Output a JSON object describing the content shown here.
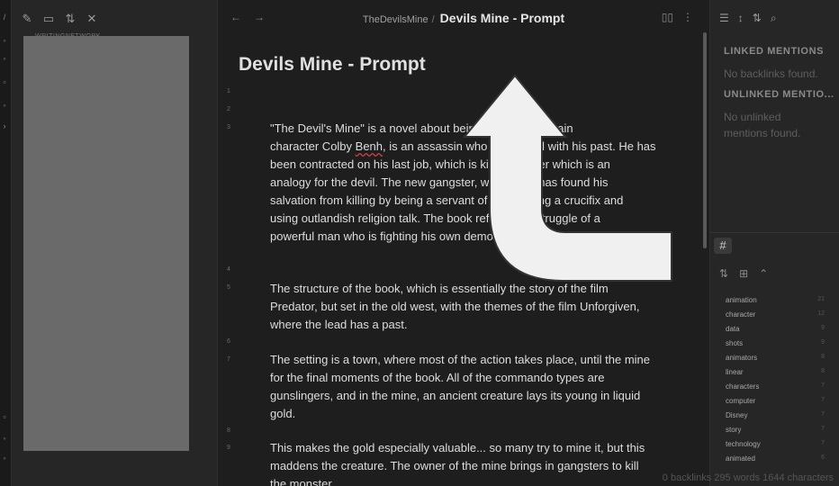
{
  "left_sidebar": {
    "vault_label": "WRITINGNETWORK"
  },
  "header": {
    "breadcrumb_parent": "TheDevilsMine",
    "breadcrumb_separator": "/",
    "breadcrumb_current": "Devils Mine - Prompt"
  },
  "document": {
    "title": "Devils Mine - Prompt",
    "line_numbers": [
      "1",
      "2",
      "3",
      "4",
      "5",
      "6",
      "7",
      "8",
      "9"
    ],
    "paragraphs": [
      {
        "before": "\"The Devil's Mine\" is a novel about being ",
        "after_hidden": "",
        "lines": [
          "\"The Devil's Mine\" is a novel about being a killer. The main",
          "character Colby Benh, is an assassin who is haunted with his past. He has",
          "been contracted on his last job, which is kill a monster which is an",
          "analogy for the devil. The new gangster, who finally has found his",
          "salvation from killing by being a servant of god holding a crucifix and",
          "using outlandish religion talk. The book reflects the struggle of a",
          "powerful man who is fighting his own demons as a protector."
        ]
      },
      {
        "lines": [
          "The structure of the book, which is essentially the story of the film",
          "Predator, but set in the old west, with the themes of the film Unforgiven,",
          "where the lead has a past."
        ]
      },
      {
        "lines": [
          "The setting is a town, where most of the action takes place, until the mine",
          "for the final moments of the book. All of the commando types are",
          "gunslingers, and in the mine, an ancient creature lays its young in liquid",
          "gold."
        ]
      },
      {
        "lines": [
          "This makes the gold especially valuable... so many try to mine it, but this",
          "maddens the creature. The owner of the mine brings in gangsters to kill",
          "the monster."
        ]
      }
    ]
  },
  "right_panel": {
    "linked_mentions": "LINKED MENTIONS",
    "no_backlinks": "No backlinks found.",
    "unlinked_mentions": "UNLINKED MENTIO...",
    "no_unlinked": "No unlinked mentions found.",
    "hash_label": "#",
    "tags": [
      {
        "name": "animation",
        "count": "21"
      },
      {
        "name": "character",
        "count": "12"
      },
      {
        "name": "data",
        "count": "9"
      },
      {
        "name": "shots",
        "count": "9"
      },
      {
        "name": "animators",
        "count": "8"
      },
      {
        "name": "linear",
        "count": "8"
      },
      {
        "name": "characters",
        "count": "7"
      },
      {
        "name": "computer",
        "count": "7"
      },
      {
        "name": "Disney",
        "count": "7"
      },
      {
        "name": "story",
        "count": "7"
      },
      {
        "name": "technology",
        "count": "7"
      },
      {
        "name": "animated",
        "count": "6"
      }
    ]
  },
  "status_bar": {
    "backlinks": "0 backlinks",
    "words": "295 words",
    "characters": "1644 characters"
  },
  "colors": {
    "editor_bg": "#1e1e1e",
    "sidebar_bg": "#262626",
    "arrow_fill": "#f0f0f0"
  }
}
